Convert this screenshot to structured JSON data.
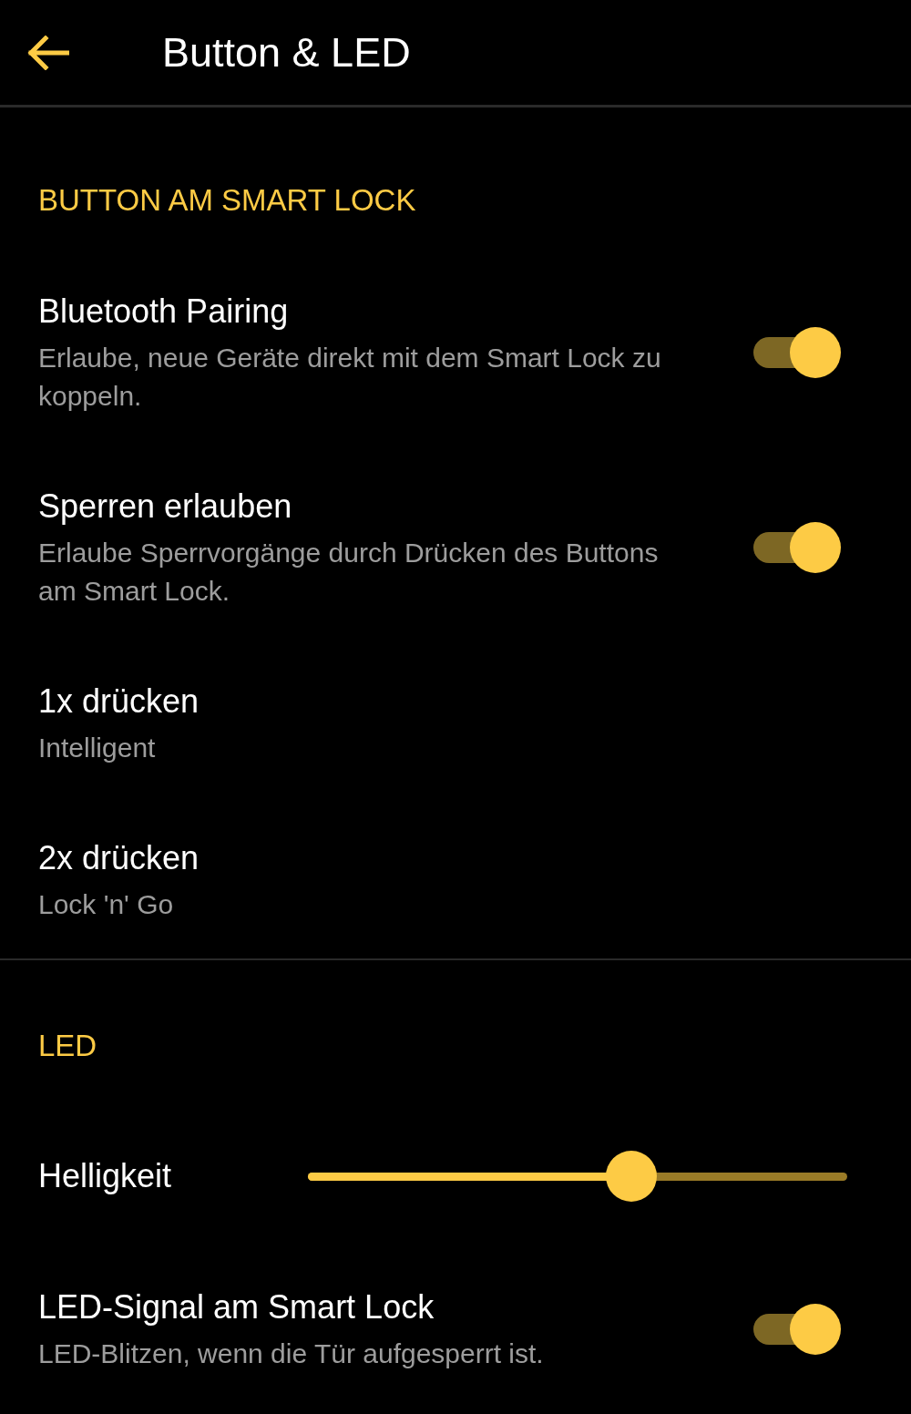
{
  "header": {
    "title": "Button & LED"
  },
  "sections": [
    {
      "title": "BUTTON AM SMART LOCK",
      "items": [
        {
          "kind": "toggle",
          "title": "Bluetooth Pairing",
          "subtitle": "Erlaube, neue Geräte direkt mit dem Smart Lock zu koppeln.",
          "on": true
        },
        {
          "kind": "toggle",
          "title": "Sperren erlauben",
          "subtitle": "Erlaube Sperrvorgänge durch Drücken des Buttons am Smart Lock.",
          "on": true
        },
        {
          "kind": "value",
          "title": "1x drücken",
          "subtitle": "Intelligent"
        },
        {
          "kind": "value",
          "title": "2x drücken",
          "subtitle": "Lock 'n' Go"
        }
      ]
    },
    {
      "title": "LED",
      "items": [
        {
          "kind": "slider",
          "title": "Helligkeit",
          "level": 0.6
        },
        {
          "kind": "toggle",
          "title": "LED-Signal am Smart Lock",
          "subtitle": "LED-Blitzen, wenn die Tür aufgesperrt ist.",
          "on": true
        }
      ]
    }
  ]
}
